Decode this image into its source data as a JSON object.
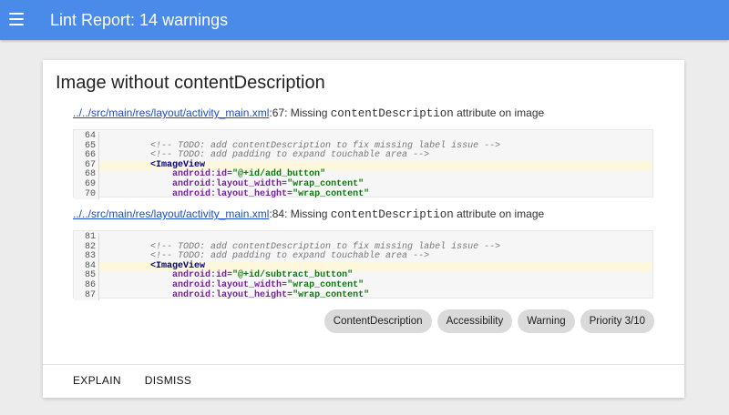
{
  "appbar": {
    "title": "Lint Report: 14 warnings"
  },
  "card": {
    "title": "Image without contentDescription",
    "issues": [
      {
        "path": "../../src/main/res/layout/activity_main.xml",
        "location": ":67: Missing ",
        "code_term": "contentDescription",
        "suffix": " attribute on image",
        "lines": [
          {
            "no": "64",
            "text": ""
          },
          {
            "no": "65",
            "comment": "<!-- TODO: add contentDescription to fix missing label issue -->"
          },
          {
            "no": "66",
            "comment": "<!-- TODO: add padding to expand touchable area -->"
          },
          {
            "no": "67",
            "tag": "<ImageView"
          },
          {
            "no": "68",
            "attr": "android:id",
            "val": "\"@+id/add_button\""
          },
          {
            "no": "69",
            "attr": "android:layout_width",
            "val": "\"wrap_content\""
          },
          {
            "no": "70",
            "attr": "android:layout_height",
            "val": "\"wrap_content\""
          }
        ]
      },
      {
        "path": "../../src/main/res/layout/activity_main.xml",
        "location": ":84: Missing ",
        "code_term": "contentDescription",
        "suffix": " attribute on image",
        "lines": [
          {
            "no": "81",
            "text": ""
          },
          {
            "no": "82",
            "comment": "<!-- TODO: add contentDescription to fix missing label issue -->"
          },
          {
            "no": "83",
            "comment": "<!-- TODO: add padding to expand touchable area -->"
          },
          {
            "no": "84",
            "tag": "<ImageView"
          },
          {
            "no": "85",
            "attr": "android:id",
            "val": "\"@+id/subtract_button\""
          },
          {
            "no": "86",
            "attr": "android:layout_width",
            "val": "\"wrap_content\""
          },
          {
            "no": "87",
            "attr": "android:layout_height",
            "val": "\"wrap_content\""
          }
        ]
      }
    ],
    "chips": [
      "ContentDescription",
      "Accessibility",
      "Warning",
      "Priority 3/10"
    ],
    "actions": {
      "explain": "EXPLAIN",
      "dismiss": "DISMISS"
    }
  },
  "colors": {
    "appbar": "#4a8ae8",
    "highlight": "#fdf7dc",
    "link": "#1a4dc9"
  },
  "icons": {
    "menu": "hamburger-menu-icon"
  }
}
